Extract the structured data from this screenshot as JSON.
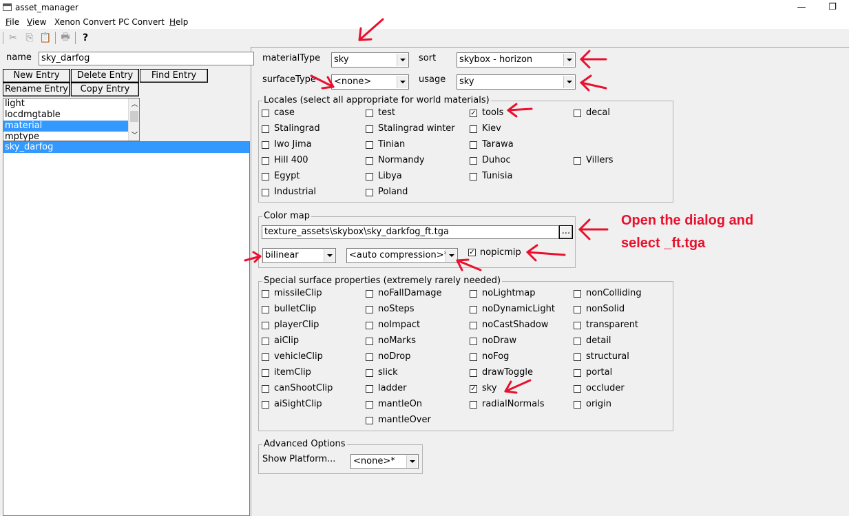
{
  "window": {
    "title": "asset_manager",
    "restore_glyph": "❐",
    "minimize_glyph": "—"
  },
  "menu": {
    "items": [
      {
        "u": "F",
        "rest": "ile"
      },
      {
        "u": "V",
        "rest": "iew"
      },
      {
        "u": "",
        "rest": "Xenon Convert"
      },
      {
        "u": "",
        "rest": "PC Convert"
      },
      {
        "u": "H",
        "rest": "elp"
      }
    ]
  },
  "toolbar": {
    "icons": [
      "cut-icon",
      "copy-icon",
      "paste-icon",
      "print-icon",
      "help-icon"
    ],
    "glyphs": [
      "✂",
      "⎘",
      "📋",
      "🖶",
      "?"
    ]
  },
  "left": {
    "name_label": "name",
    "name_value": "sky_darfog",
    "buttons": {
      "new": "New Entry",
      "delete": "Delete Entry",
      "find": "Find Entry",
      "rename": "Rename Entry",
      "copy": "Copy Entry"
    },
    "types": [
      "light",
      "locdmgtable",
      "material",
      "mptype"
    ],
    "types_selected": 2,
    "entries": [
      "sky_darfog"
    ],
    "entries_selected": 0
  },
  "material": {
    "materialType_label": "materialType",
    "materialType_value": "sky",
    "sort_label": "sort",
    "sort_value": "skybox - horizon",
    "surfaceType_label": "surfaceType",
    "surfaceType_value": "<none>",
    "usage_label": "usage",
    "usage_value": "sky"
  },
  "locales": {
    "title": "Locales (select all appropriate for world materials)",
    "columns": [
      [
        {
          "label": "case",
          "checked": false
        },
        {
          "label": "Stalingrad",
          "checked": false
        },
        {
          "label": "Iwo Jima",
          "checked": false
        },
        {
          "label": "Hill 400",
          "checked": false
        },
        {
          "label": "Egypt",
          "checked": false
        },
        {
          "label": "Industrial",
          "checked": false
        }
      ],
      [
        {
          "label": "test",
          "checked": false
        },
        {
          "label": "Stalingrad winter",
          "checked": false
        },
        {
          "label": "Tinian",
          "checked": false
        },
        {
          "label": "Normandy",
          "checked": false
        },
        {
          "label": "Libya",
          "checked": false
        },
        {
          "label": "Poland",
          "checked": false
        }
      ],
      [
        {
          "label": "tools",
          "checked": true
        },
        {
          "label": "Kiev",
          "checked": false
        },
        {
          "label": "Tarawa",
          "checked": false
        },
        {
          "label": "Duhoc",
          "checked": false
        },
        {
          "label": "Tunisia",
          "checked": false
        }
      ],
      [
        {
          "label": "decal",
          "checked": false
        },
        null,
        null,
        {
          "label": "Villers",
          "checked": false
        }
      ]
    ]
  },
  "colormap": {
    "title": "Color map",
    "path": "texture_assets\\skybox\\sky_darkfog_ft.tga",
    "browse_label": "...",
    "filter_value": "bilinear",
    "compression_value": "<auto compression>*",
    "nopicmip_label": "nopicmip",
    "nopicmip_checked": true
  },
  "special": {
    "title": "Special surface properties (extremely rarely needed)",
    "columns": [
      [
        {
          "label": "missileClip",
          "checked": false
        },
        {
          "label": "bulletClip",
          "checked": false
        },
        {
          "label": "playerClip",
          "checked": false
        },
        {
          "label": "aiClip",
          "checked": false
        },
        {
          "label": "vehicleClip",
          "checked": false
        },
        {
          "label": "itemClip",
          "checked": false
        },
        {
          "label": "canShootClip",
          "checked": false
        },
        {
          "label": "aiSightClip",
          "checked": false
        }
      ],
      [
        {
          "label": "noFallDamage",
          "checked": false
        },
        {
          "label": "noSteps",
          "checked": false
        },
        {
          "label": "noImpact",
          "checked": false
        },
        {
          "label": "noMarks",
          "checked": false
        },
        {
          "label": "noDrop",
          "checked": false
        },
        {
          "label": "slick",
          "checked": false
        },
        {
          "label": "ladder",
          "checked": false
        },
        {
          "label": "mantleOn",
          "checked": false
        },
        {
          "label": "mantleOver",
          "checked": false
        }
      ],
      [
        {
          "label": "noLightmap",
          "checked": false
        },
        {
          "label": "noDynamicLight",
          "checked": false
        },
        {
          "label": "noCastShadow",
          "checked": false
        },
        {
          "label": "noDraw",
          "checked": false
        },
        {
          "label": "noFog",
          "checked": false
        },
        {
          "label": "drawToggle",
          "checked": false
        },
        {
          "label": "sky",
          "checked": true
        },
        {
          "label": "radialNormals",
          "checked": false
        }
      ],
      [
        {
          "label": "nonColliding",
          "checked": false
        },
        {
          "label": "nonSolid",
          "checked": false
        },
        {
          "label": "transparent",
          "checked": false
        },
        {
          "label": "detail",
          "checked": false
        },
        {
          "label": "structural",
          "checked": false
        },
        {
          "label": "portal",
          "checked": false
        },
        {
          "label": "occluder",
          "checked": false
        },
        {
          "label": "origin",
          "checked": false
        }
      ]
    ]
  },
  "advanced": {
    "title": "Advanced Options",
    "platform_label": "Show Platform...",
    "platform_value": "<none>*"
  },
  "annotation": {
    "line1": "Open the dialog and",
    "line2": "select _ft.tga",
    "color": "#e8102d"
  },
  "colors": {
    "selection": "#3399ff",
    "window_bg": "#f0f0f0"
  }
}
